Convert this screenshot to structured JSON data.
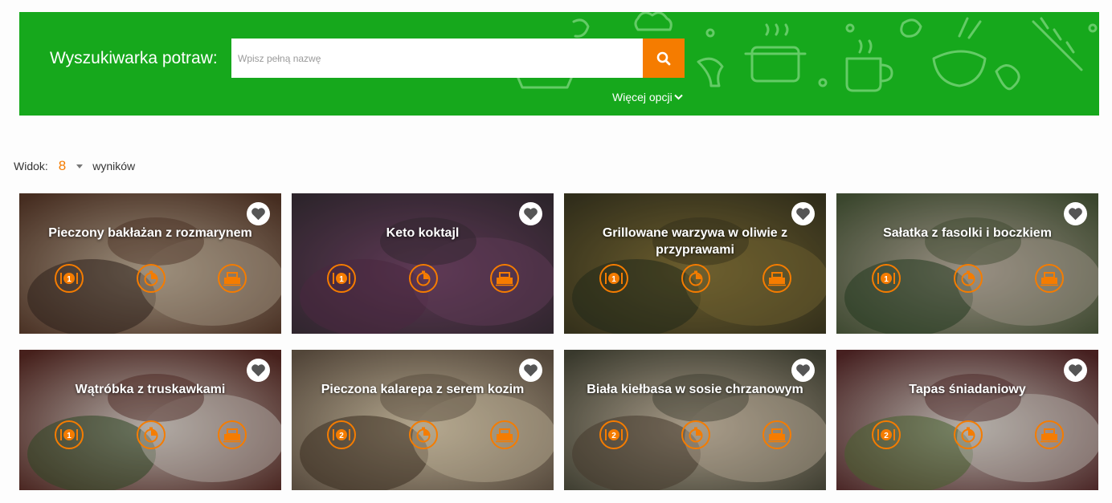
{
  "search": {
    "label": "Wyszukiwarka potraw:",
    "placeholder": "Wpisz pełną nazwę",
    "more_options": "Więcej opcji"
  },
  "view": {
    "prefix": "Widok:",
    "count": "8",
    "suffix": "wyników"
  },
  "colors": {
    "brand_green": "#16a81c",
    "accent_orange": "#f57c00"
  },
  "recipes": [
    {
      "title": "Pieczony bakłażan z rozmarynem",
      "difficulty_level": "1"
    },
    {
      "title": "Keto koktajl",
      "difficulty_level": "1"
    },
    {
      "title": "Grillowane warzywa w oliwie z przyprawami",
      "difficulty_level": "1"
    },
    {
      "title": "Sałatka z fasolki i boczkiem",
      "difficulty_level": "1"
    },
    {
      "title": "Wątróbka z truskawkami",
      "difficulty_level": "1"
    },
    {
      "title": "Pieczona kalarepa z serem kozim",
      "difficulty_level": "2"
    },
    {
      "title": "Biała kiełbasa w sosie chrzanowym",
      "difficulty_level": "2"
    },
    {
      "title": "Tapas śniadaniowy",
      "difficulty_level": "2"
    }
  ]
}
